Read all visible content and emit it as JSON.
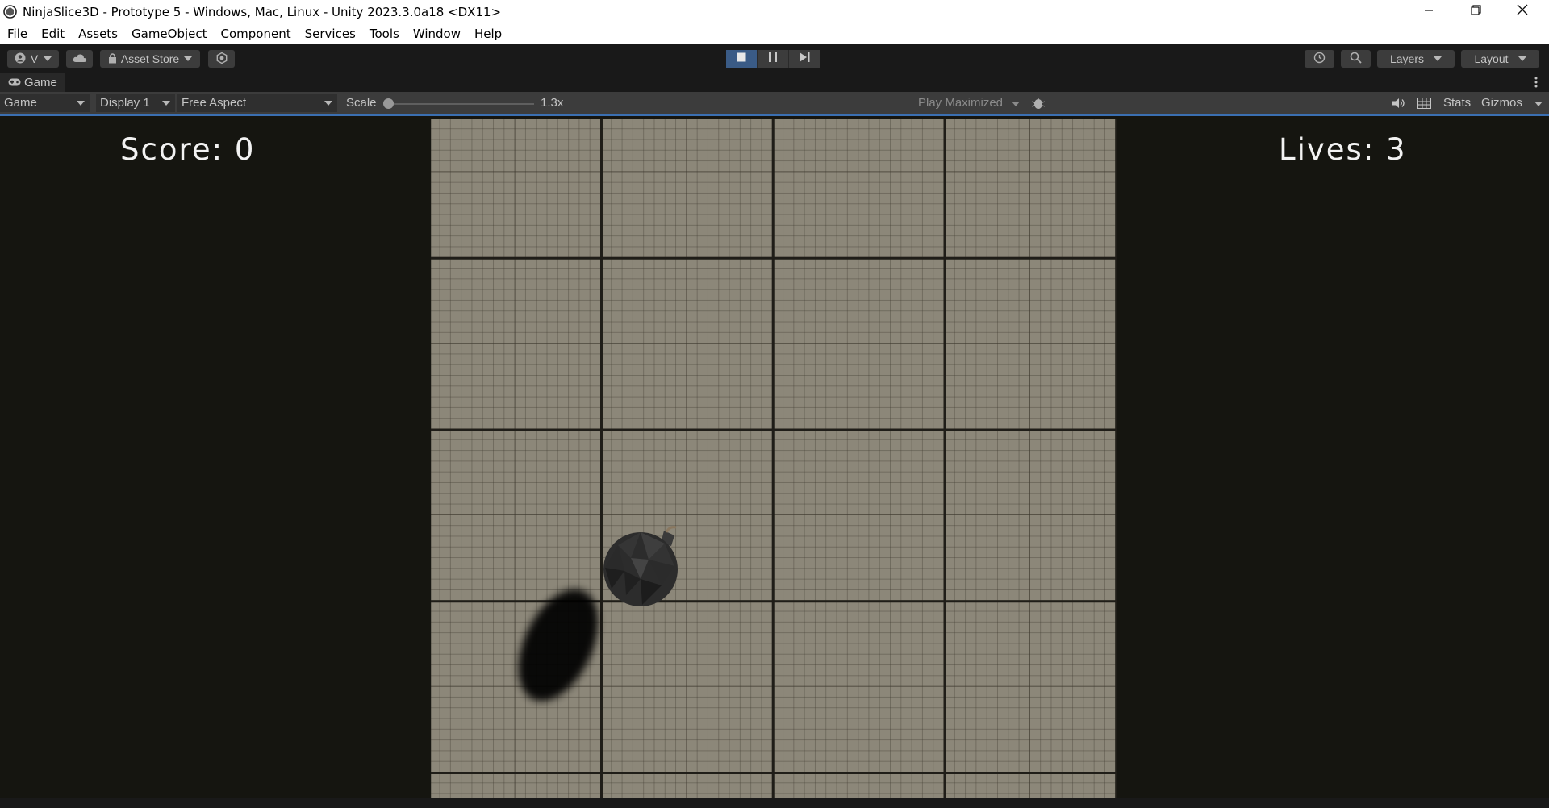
{
  "window": {
    "title": "NinjaSlice3D - Prototype 5 - Windows, Mac, Linux - Unity 2023.3.0a18 <DX11>"
  },
  "menu": [
    "File",
    "Edit",
    "Assets",
    "GameObject",
    "Component",
    "Services",
    "Tools",
    "Window",
    "Help"
  ],
  "toolbar": {
    "account_label": "V",
    "asset_store_label": "Asset Store",
    "layers_label": "Layers",
    "layout_label": "Layout"
  },
  "tab": {
    "label": "Game"
  },
  "gamebar": {
    "view_mode": "Game",
    "display": "Display 1",
    "aspect": "Free Aspect",
    "scale_label": "Scale",
    "scale_value": "1.3x",
    "play_maximized": "Play Maximized",
    "stats_label": "Stats",
    "gizmos_label": "Gizmos"
  },
  "game": {
    "score_text": "Score: 0",
    "lives_text": "Lives: 3"
  },
  "colors": {
    "accent": "#3b6fb1",
    "editor_bg": "#191919",
    "panel": "#3c3c3c",
    "floor": "#8c8779",
    "hud_text": "#f2f2f2"
  },
  "icons": [
    "unity-icon",
    "minimize-icon",
    "restore-icon",
    "close-icon",
    "account-icon",
    "cloud-icon",
    "lock-icon",
    "settings-icon",
    "stop-icon",
    "pause-icon",
    "step-icon",
    "history-icon",
    "search-icon",
    "gamepad-icon",
    "kebab-icon",
    "bug-icon",
    "audio-icon",
    "grid-icon"
  ]
}
